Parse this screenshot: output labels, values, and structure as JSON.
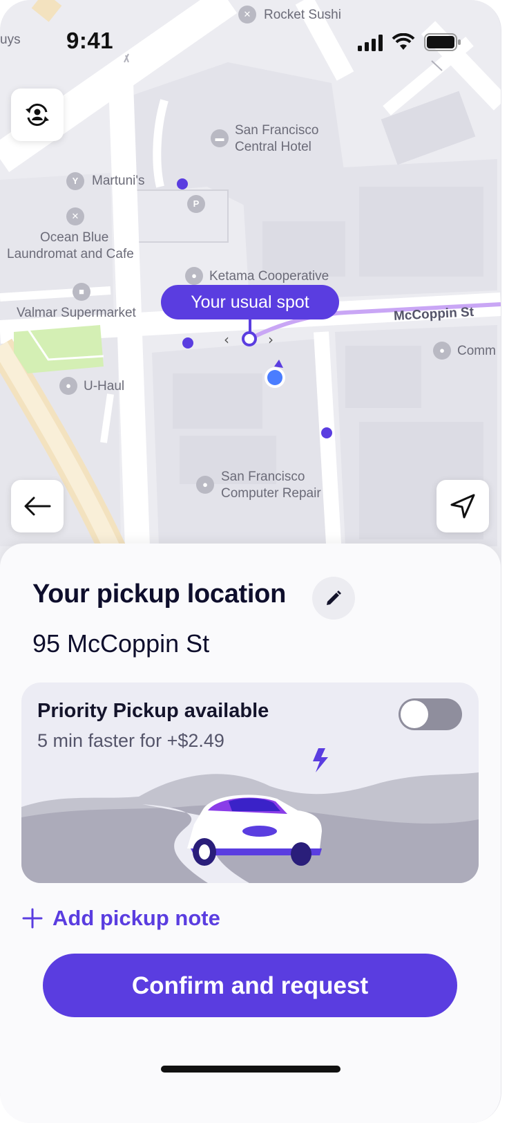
{
  "status_bar": {
    "time": "9:41"
  },
  "map": {
    "labels": {
      "rocket_sushi": "Rocket Sushi",
      "hotel_line1": "San Francisco",
      "hotel_line2": "Central Hotel",
      "martunis": "Martuni's",
      "ocean_blue_line1": "Ocean Blue",
      "ocean_blue_line2": "Laundromat and Cafe",
      "ketama": "Ketama Cooperative",
      "valmar": "Valmar Supermarket",
      "street": "McCoppin St",
      "uhaul": "U-Haul",
      "repair_line1": "San Francisco",
      "repair_line2": "Computer Repair",
      "comm": "Comm",
      "edge_left": "uys"
    },
    "tooltip": "Your usual spot",
    "route_color": "#c9a6f5",
    "accent": "#5a3de0"
  },
  "sheet": {
    "title": "Your pickup location",
    "address": "95 McCoppin St",
    "priority": {
      "title": "Priority Pickup available",
      "subtitle": "5 min faster for +$2.49",
      "enabled": false
    },
    "add_note_label": "Add pickup note",
    "confirm_label": "Confirm and request"
  }
}
